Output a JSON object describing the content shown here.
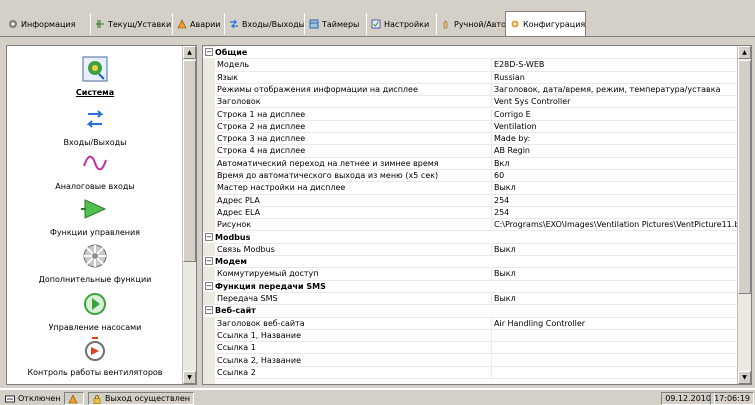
{
  "tabs": [
    {
      "label": "Информация",
      "icon": "info-gear-icon"
    },
    {
      "label": "Текущ/Уставки",
      "icon": "chart-icon"
    },
    {
      "label": "Аварии",
      "icon": "alarm-icon"
    },
    {
      "label": "Входы/Выходы",
      "icon": "io-arrows-icon"
    },
    {
      "label": "Таймеры",
      "icon": "timer-icon"
    },
    {
      "label": "Настройки",
      "icon": "settings-icon"
    },
    {
      "label": "Ручной/Авто",
      "icon": "hand-icon"
    },
    {
      "label": "Конфигурация",
      "icon": "config-icon",
      "active": true
    }
  ],
  "nav": [
    {
      "label": "Система",
      "icon": "system-icon",
      "selected": true
    },
    {
      "label": "Входы/Выходы",
      "icon": "io-arrows-icon"
    },
    {
      "label": "Аналоговые входы",
      "icon": "analog-wave-icon"
    },
    {
      "label": "Функции управления",
      "icon": "control-function-icon"
    },
    {
      "label": "Дополнительные функции",
      "icon": "additional-functions-icon"
    },
    {
      "label": "Управление насосами",
      "icon": "pump-icon"
    },
    {
      "label": "Контроль работы вентиляторов",
      "icon": "fan-control-icon"
    }
  ],
  "grid_rows": [
    {
      "type": "cat",
      "label": "Общие"
    },
    {
      "label": "Модель",
      "value": "E28D-S-WEB"
    },
    {
      "label": "Язык",
      "value": "Russian"
    },
    {
      "label": "Режимы отображения информации на дисплее",
      "value": "Заголовок, дата/время, режим, температура/уставка"
    },
    {
      "label": "Заголовок",
      "value": "Vent Sys Controller"
    },
    {
      "label": "Строка 1 на дисплее",
      "value": "Corrigo E"
    },
    {
      "label": "Строка 2 на дисплее",
      "value": "Ventilation"
    },
    {
      "label": "Строка 3 на дисплее",
      "value": "Made by:"
    },
    {
      "label": "Строка 4 на дисплее",
      "value": "AB Regin"
    },
    {
      "label": "Автоматический переход на летнее и зимнее время",
      "value": "Вкл"
    },
    {
      "label": "Время до автоматического выхода из меню (x5 сек)",
      "value": "60"
    },
    {
      "label": "Мастер настройки на дисплее",
      "value": "Выкл"
    },
    {
      "label": "Адрес PLA",
      "value": "254"
    },
    {
      "label": "Адрес ELA",
      "value": "254"
    },
    {
      "label": "Рисунок",
      "value": "C:\\Programs\\EXO\\Images\\Ventilation Pictures\\VentPicture11.b.."
    },
    {
      "type": "cat",
      "label": "Modbus"
    },
    {
      "label": "Связь Modbus",
      "value": "Выкл"
    },
    {
      "type": "cat",
      "label": "Модем"
    },
    {
      "label": "Коммутируемый доступ",
      "value": "Выкл"
    },
    {
      "type": "cat",
      "label": "Функция передачи SMS"
    },
    {
      "label": "Передача SMS",
      "value": "Выкл"
    },
    {
      "type": "cat",
      "label": "Веб-сайт"
    },
    {
      "label": "Заголовок веб-сайта",
      "value": "Air Handling Controller"
    },
    {
      "label": "Ссылка 1, Название",
      "value": ""
    },
    {
      "label": "Ссылка 1",
      "value": ""
    },
    {
      "label": "Ссылка 2, Название",
      "value": ""
    },
    {
      "label": "Ссылка 2",
      "value": ""
    }
  ],
  "status": {
    "connection": "Отключен",
    "message": "Выход осуществлен",
    "date": "09.12.2010",
    "time": "17:06:19"
  },
  "colors": {
    "accent": "#3a6ea5",
    "panel": "#d4d0c8"
  }
}
